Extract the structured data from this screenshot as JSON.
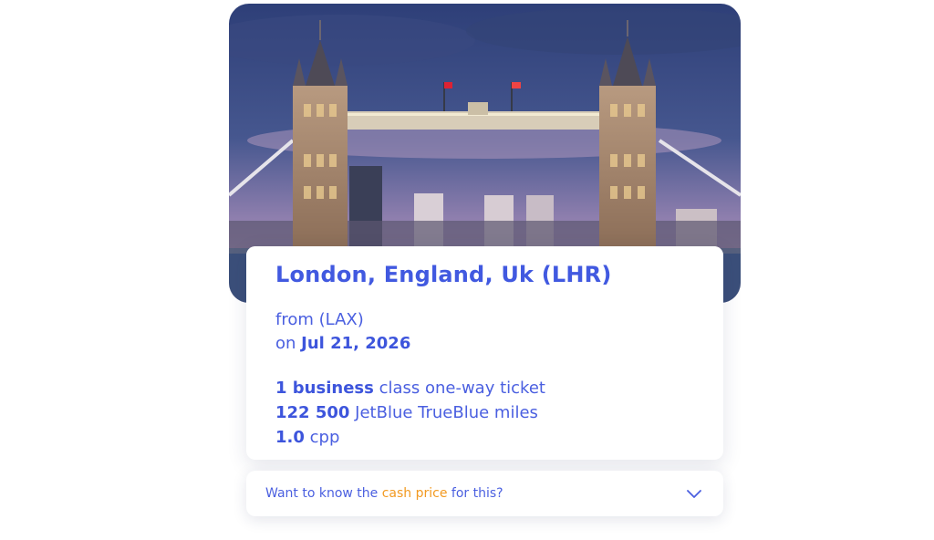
{
  "destination": {
    "title": "London, England, Uk (LHR)",
    "from_prefix": "from",
    "from_code": "(LAX)",
    "on_prefix": "on",
    "date": "Jul 21, 2026"
  },
  "ticket": {
    "count_cabin": "1 business",
    "ticket_rest": "class one-way ticket",
    "miles_amount": "122 500",
    "miles_program": "JetBlue TrueBlue miles",
    "cpp_value": "1.0",
    "cpp_unit": "cpp"
  },
  "cash_prompt": {
    "before": "Want to know the",
    "highlight": "cash price",
    "after": "for this?"
  },
  "colors": {
    "primary": "#4159e0",
    "accent": "#f29a22"
  },
  "icons": {
    "expand": "chevron-down-icon"
  }
}
